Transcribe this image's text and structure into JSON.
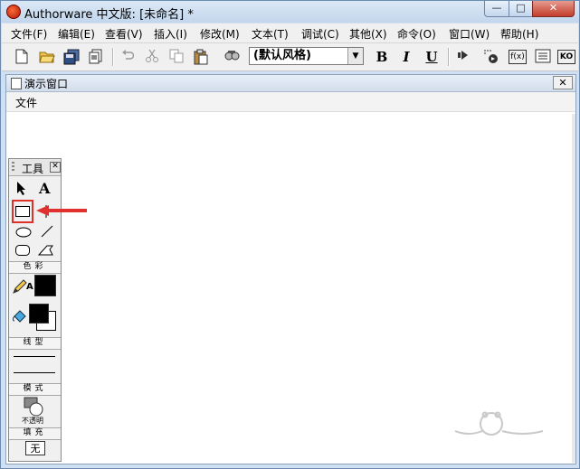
{
  "window": {
    "title": "Authorware 中文版: [未命名] *"
  },
  "title_buttons": {
    "minimize": "—",
    "maximize": "□",
    "close": "✕"
  },
  "menu": [
    {
      "label": "文件(F)"
    },
    {
      "label": "编辑(E)"
    },
    {
      "label": "查看(V)"
    },
    {
      "label": "插入(I)"
    },
    {
      "label": "修改(M)"
    },
    {
      "label": "文本(T)"
    },
    {
      "label": "调试(C)"
    },
    {
      "label": "其他(X)"
    },
    {
      "label": "命令(O)"
    },
    {
      "label": "窗口(W)"
    },
    {
      "label": "帮助(H)"
    }
  ],
  "toolbar": {
    "icons": [
      "new-icon",
      "open-icon",
      "save-all-icon",
      "import-icon",
      "undo-icon",
      "cut-icon",
      "copy-icon",
      "paste-icon",
      "find-icon"
    ],
    "style_select": "(默认风格)",
    "bold": "B",
    "italic": "I",
    "underline": "U",
    "icons_right": [
      "run-icon",
      "control-panel-icon",
      "functions-icon",
      "variables-icon",
      "knowledge-objects-icon"
    ],
    "functions_label": "f(x)",
    "ko_label": "KO"
  },
  "presentation": {
    "title": "演示窗口",
    "close": "✕",
    "menu_file": "文件"
  },
  "tools_panel": {
    "title": "工具",
    "close": "✕",
    "text_tool": "A",
    "color_label": "色彩",
    "line_label": "线型",
    "mode_label": "模式",
    "mode_value": "不透明",
    "fill_label": "填充",
    "fill_value": "无",
    "pen_label": "A"
  },
  "colors": {
    "highlight": "#e0302a",
    "arrow": "#e03030"
  }
}
